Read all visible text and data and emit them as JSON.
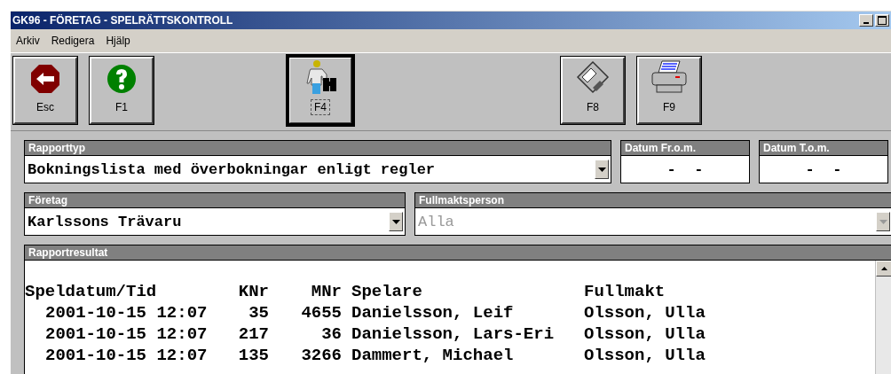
{
  "window": {
    "title": "GK96 - FÖRETAG - SPELRÄTTSKONTROLL"
  },
  "menu": [
    {
      "label": "Arkiv"
    },
    {
      "label": "Redigera"
    },
    {
      "label": "Hjälp"
    }
  ],
  "toolbar": [
    {
      "buttons": [
        {
          "label": "Esc",
          "kind": "stop",
          "selected": false
        },
        {
          "label": "F1",
          "kind": "help",
          "selected": false
        }
      ]
    },
    {
      "buttons": [
        {
          "label": "F4",
          "kind": "search",
          "selected": true
        }
      ]
    },
    {
      "buttons": [
        {
          "label": "F8",
          "kind": "disk",
          "selected": false
        },
        {
          "label": "F9",
          "kind": "printer",
          "selected": false
        }
      ]
    }
  ],
  "form": {
    "rapporttyp": {
      "label": "Rapporttyp",
      "value": "Bokningslista med överbokningar enligt regler",
      "disabled": false
    },
    "datum_from": {
      "label": "Datum Fr.o.m.",
      "value": "-  -"
    },
    "datum_tom": {
      "label": "Datum T.o.m.",
      "value": "-  -"
    },
    "foretag": {
      "label": "Företag",
      "value": "Karlssons Trävaru",
      "disabled": false
    },
    "fullmaktsperson": {
      "label": "Fullmaktsperson",
      "value": "Alla",
      "disabled": true
    }
  },
  "result": {
    "label": "Rapportresultat",
    "columns": [
      "Speldatum/Tid",
      "KNr",
      "MNr",
      "Spelare",
      "Fullmakt"
    ],
    "rows": [
      [
        "2001-10-15 12:07",
        "35",
        "4655",
        "Danielsson, Leif",
        "Olsson, Ulla"
      ],
      [
        "2001-10-15 12:07",
        "217",
        "36",
        "Danielsson, Lars-Eri",
        "Olsson, Ulla"
      ],
      [
        "2001-10-15 12:07",
        "135",
        "3266",
        "Dammert, Michael",
        "Olsson, Ulla"
      ]
    ]
  }
}
